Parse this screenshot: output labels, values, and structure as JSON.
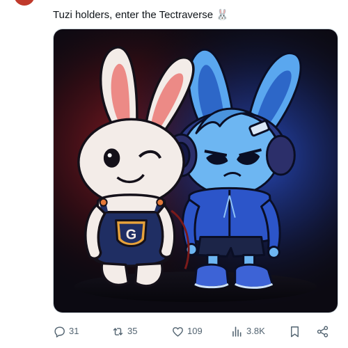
{
  "tweet": {
    "text": "Tuzi holders, enter the Tectraverse 🐰",
    "media_alt": "Illustration of two cartoon rabbits: a white winking bunny in navy overalls with a G badge, and a blue bunny with headphones, hoodie and sneakers",
    "badge_letter": "G"
  },
  "actions": {
    "reply": {
      "icon": "reply-icon",
      "count": "31"
    },
    "retweet": {
      "icon": "retweet-icon",
      "count": "35"
    },
    "like": {
      "icon": "heart-icon",
      "count": "109"
    },
    "views": {
      "icon": "views-icon",
      "count": "3.8K"
    },
    "bookmark": {
      "icon": "bookmark-icon"
    },
    "share": {
      "icon": "share-icon"
    }
  },
  "colors": {
    "text": "#0f1419",
    "muted": "#536471",
    "media_bg": "#0c0a12",
    "glow_red": "#8a1c24",
    "glow_blue": "#2a4fc9",
    "white_bunny": "#f3ece8",
    "blue_bunny": "#5aa7ef",
    "overalls": "#1f2e63",
    "hoodie": "#2c55c9"
  }
}
